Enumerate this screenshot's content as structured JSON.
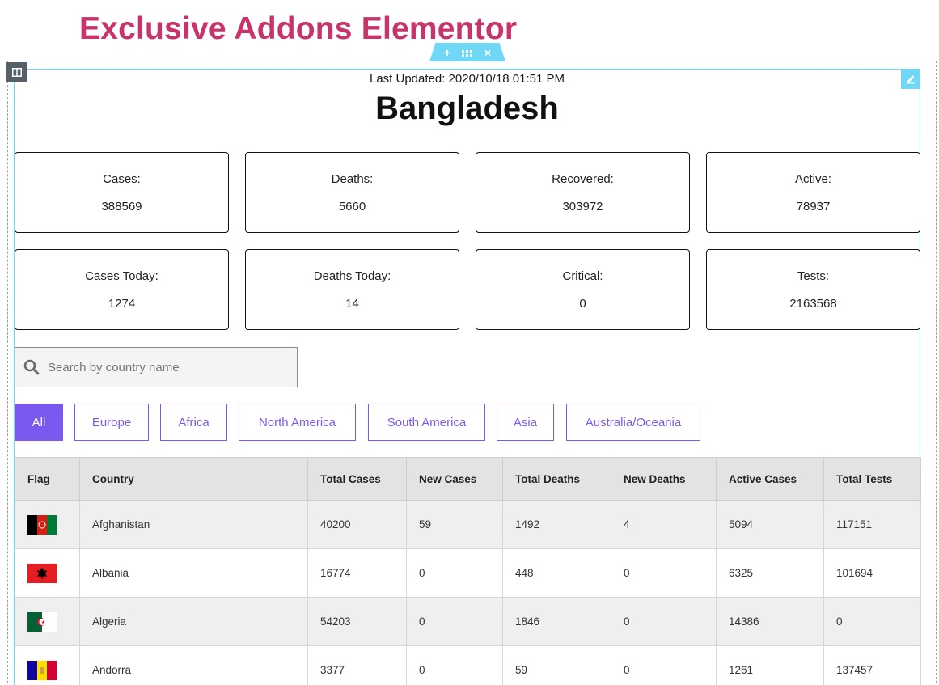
{
  "brand": {
    "title": "Exclusive Addons Elementor"
  },
  "editor": {
    "section_handle": {
      "add": "+",
      "move": "⋮⋮⋮",
      "close": "×"
    }
  },
  "widget": {
    "last_updated": "Last Updated: 2020/10/18 01:51 PM",
    "country": "Bangladesh",
    "stats": [
      {
        "label": "Cases:",
        "value": "388569"
      },
      {
        "label": "Deaths:",
        "value": "5660"
      },
      {
        "label": "Recovered:",
        "value": "303972"
      },
      {
        "label": "Active:",
        "value": "78937"
      },
      {
        "label": "Cases Today:",
        "value": "1274"
      },
      {
        "label": "Deaths Today:",
        "value": "14"
      },
      {
        "label": "Critical:",
        "value": "0"
      },
      {
        "label": "Tests:",
        "value": "2163568"
      }
    ],
    "search": {
      "placeholder": "Search by country name",
      "icon": "search-icon"
    },
    "filters": [
      {
        "label": "All",
        "active": true
      },
      {
        "label": "Europe",
        "active": false
      },
      {
        "label": "Africa",
        "active": false
      },
      {
        "label": "North America",
        "active": false
      },
      {
        "label": "South America",
        "active": false
      },
      {
        "label": "Asia",
        "active": false
      },
      {
        "label": "Australia/Oceania",
        "active": false
      }
    ],
    "table": {
      "headers": [
        "Flag",
        "Country",
        "Total Cases",
        "New Cases",
        "Total Deaths",
        "New Deaths",
        "Active Cases",
        "Total Tests"
      ],
      "rows": [
        {
          "flag": "afghanistan-flag",
          "country": "Afghanistan",
          "total_cases": "40200",
          "new_cases": "59",
          "total_deaths": "1492",
          "new_deaths": "4",
          "active_cases": "5094",
          "total_tests": "117151"
        },
        {
          "flag": "albania-flag",
          "country": "Albania",
          "total_cases": "16774",
          "new_cases": "0",
          "total_deaths": "448",
          "new_deaths": "0",
          "active_cases": "6325",
          "total_tests": "101694"
        },
        {
          "flag": "algeria-flag",
          "country": "Algeria",
          "total_cases": "54203",
          "new_cases": "0",
          "total_deaths": "1846",
          "new_deaths": "0",
          "active_cases": "14386",
          "total_tests": "0"
        },
        {
          "flag": "andorra-flag",
          "country": "Andorra",
          "total_cases": "3377",
          "new_cases": "0",
          "total_deaths": "59",
          "new_deaths": "0",
          "active_cases": "1261",
          "total_tests": "137457"
        }
      ]
    }
  },
  "colors": {
    "brand": "#c8336a",
    "accent": "#7b58f0",
    "editor_handle": "#71d7f7",
    "table_header": "#e3e3e3"
  }
}
